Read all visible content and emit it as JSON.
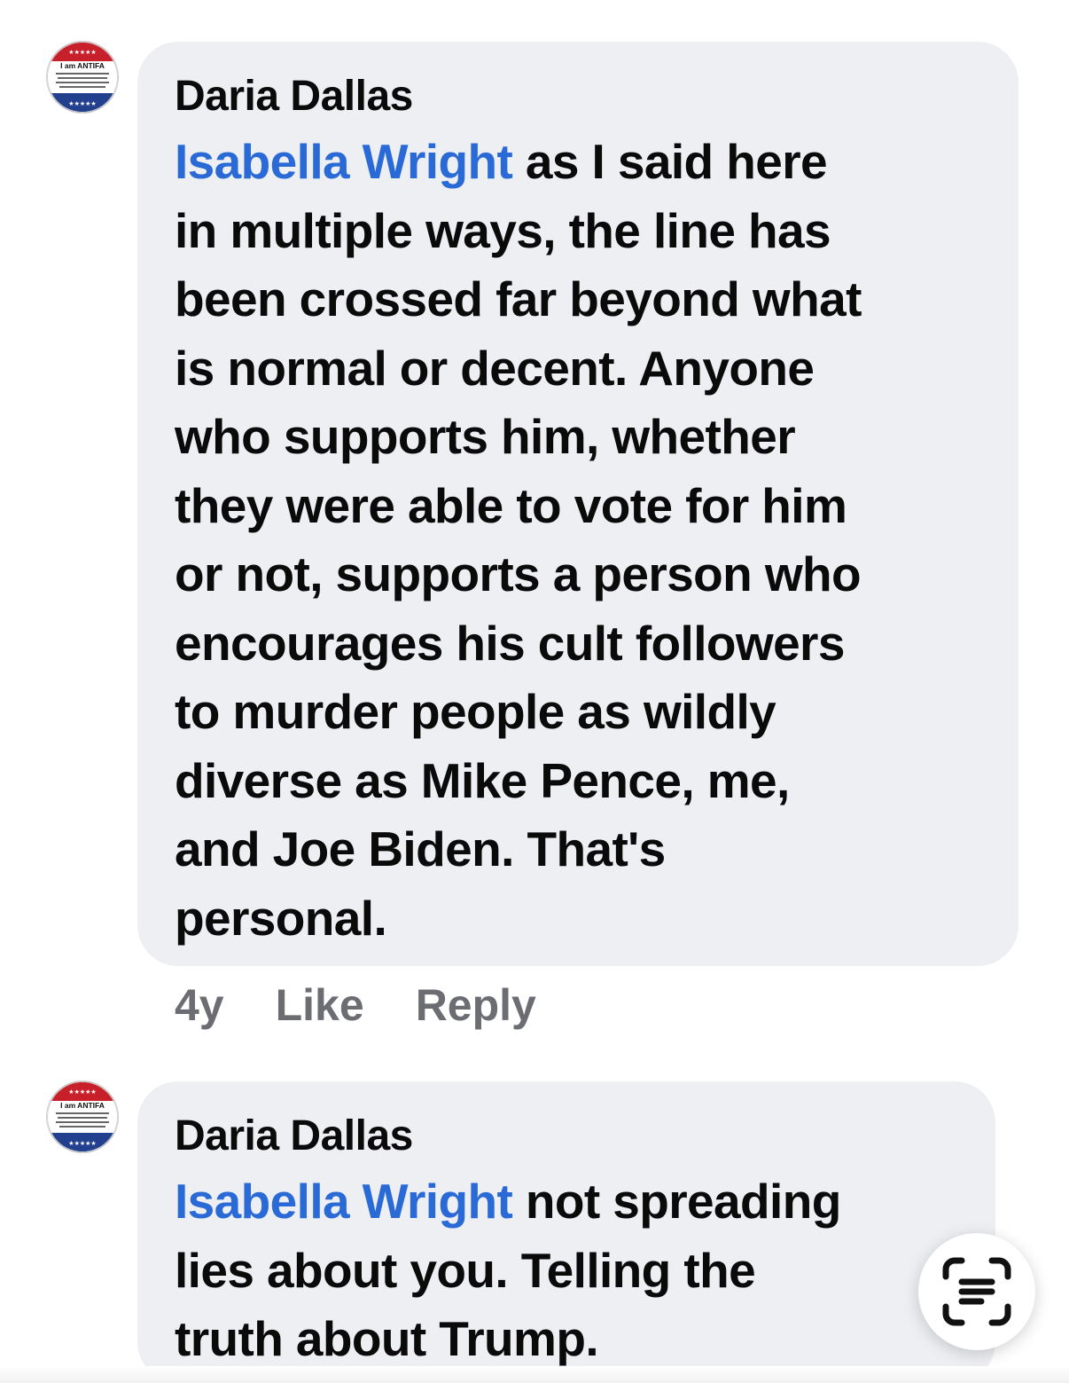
{
  "comments": [
    {
      "author": "Daria Dallas",
      "mention": "Isabella Wright",
      "lines": [
        "as I said here",
        "in multiple ways, the line has",
        "been crossed far beyond what",
        "is normal or decent. Anyone",
        "who supports him, whether",
        "they were able to vote for him",
        "or not, supports a person who",
        "encourages his cult followers",
        "to murder people as wildly",
        "diverse as Mike Pence, me,",
        "and Joe Biden. That's",
        "personal."
      ],
      "timestamp": "4y",
      "like_label": "Like",
      "reply_label": "Reply",
      "avatar": {
        "badge_text": "I am ANTIFA",
        "icon": "campaign-button-avatar"
      }
    },
    {
      "author": "Daria Dallas",
      "mention": "Isabella Wright",
      "lines": [
        "not spreading",
        "lies about you. Telling the",
        "truth about Trump."
      ],
      "avatar": {
        "badge_text": "I am ANTIFA",
        "icon": "campaign-button-avatar"
      }
    }
  ],
  "overlay": {
    "icon": "live-text-scan-icon"
  },
  "colors": {
    "bubble": "#eeeff3",
    "mention": "#2a6ad6",
    "meta": "#6b6d72",
    "badge_red": "#c8202b",
    "badge_blue": "#23408e"
  }
}
